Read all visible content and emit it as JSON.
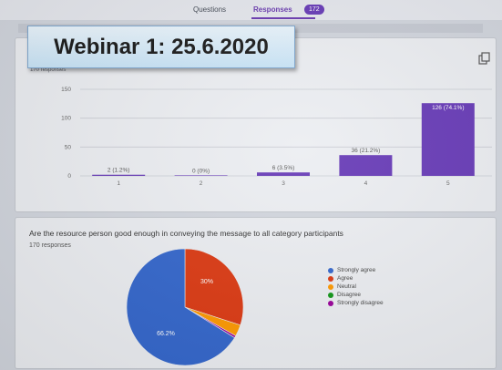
{
  "header": {
    "tabs": [
      {
        "label": "Questions"
      },
      {
        "label": "Responses"
      }
    ],
    "responses_badge": "172"
  },
  "overlay_title": "Webinar 1: 25.6.2020",
  "question1": {
    "response_count": "170 responses"
  },
  "question2": {
    "title": "Are the resource person good enough in conveying the message to all category participants",
    "response_count": "170 responses"
  },
  "colors": {
    "purple": "#673ab7",
    "strongly_agree": "#3366cc",
    "agree": "#dc3912",
    "neutral": "#ff9900",
    "disagree": "#109618",
    "strongly_disagree": "#990099"
  },
  "chart_data": [
    {
      "type": "bar",
      "categories": [
        "1",
        "2",
        "3",
        "4",
        "5"
      ],
      "values": [
        2,
        0,
        6,
        36,
        126
      ],
      "data_labels": [
        "2 (1.2%)",
        "0 (0%)",
        "6 (3.5%)",
        "36 (21.2%)",
        "126 (74.1%)"
      ],
      "yticks": [
        "0",
        "50",
        "100",
        "150"
      ],
      "ylim": [
        0,
        150
      ],
      "grid": true
    },
    {
      "type": "pie",
      "labels": [
        "Strongly agree",
        "Agree",
        "Neutral",
        "Disagree",
        "Strongly disagree"
      ],
      "values": [
        66.2,
        30,
        3.2,
        0,
        0.6
      ],
      "slice_labels": [
        "66.2%",
        "30%"
      ],
      "legend": "right"
    }
  ]
}
